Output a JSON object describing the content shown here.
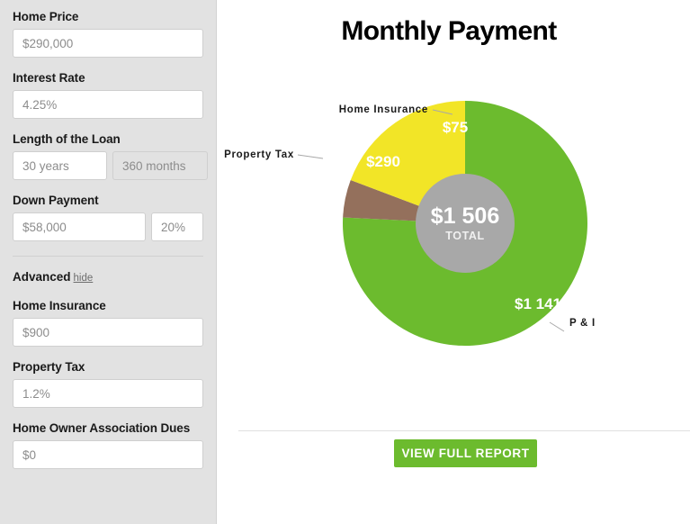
{
  "sidebar": {
    "fields": [
      {
        "id": "home-price",
        "label": "Home Price",
        "value": "$290,000"
      },
      {
        "id": "interest-rate",
        "label": "Interest Rate",
        "value": "4.25%"
      }
    ],
    "loan_length": {
      "label": "Length of the Loan",
      "years_value": "30 years",
      "months_value": "360 months"
    },
    "down_payment": {
      "label": "Down Payment",
      "amount_value": "$58,000",
      "percent_value": "20%"
    },
    "advanced": {
      "label": "Advanced",
      "toggle_label": "hide",
      "fields": [
        {
          "id": "home-insurance",
          "label": "Home Insurance",
          "value": "$900"
        },
        {
          "id": "property-tax",
          "label": "Property Tax",
          "value": "1.2%"
        },
        {
          "id": "hoa-dues",
          "label": "Home Owner Association Dues",
          "value": "$0"
        }
      ]
    }
  },
  "main": {
    "title": "Monthly Payment",
    "view_report_label": "VIEW FULL REPORT",
    "bottom_note": ""
  },
  "chart_data": {
    "type": "pie",
    "title": "Monthly Payment",
    "donut": true,
    "center_value": "$1 506",
    "center_label": "TOTAL",
    "total": 1506,
    "categories": [
      "P & I",
      "Home Insurance",
      "Property Tax"
    ],
    "values": [
      1141,
      75,
      290
    ],
    "value_labels": [
      "$1 141",
      "$75",
      "$290"
    ],
    "colors": [
      "#6cbb2e",
      "#94705c",
      "#f2e527"
    ],
    "center_fill": "#a8a8a8",
    "start_angle_deg": 0,
    "legend": "callouts",
    "callouts": [
      {
        "label": "Home Insurance",
        "value_label": "$75",
        "color": "#94705c"
      },
      {
        "label": "Property Tax",
        "value_label": "$290",
        "color": "#f2e527"
      },
      {
        "label": "P & I",
        "value_label": "$1 141",
        "color": "#6cbb2e"
      }
    ]
  }
}
